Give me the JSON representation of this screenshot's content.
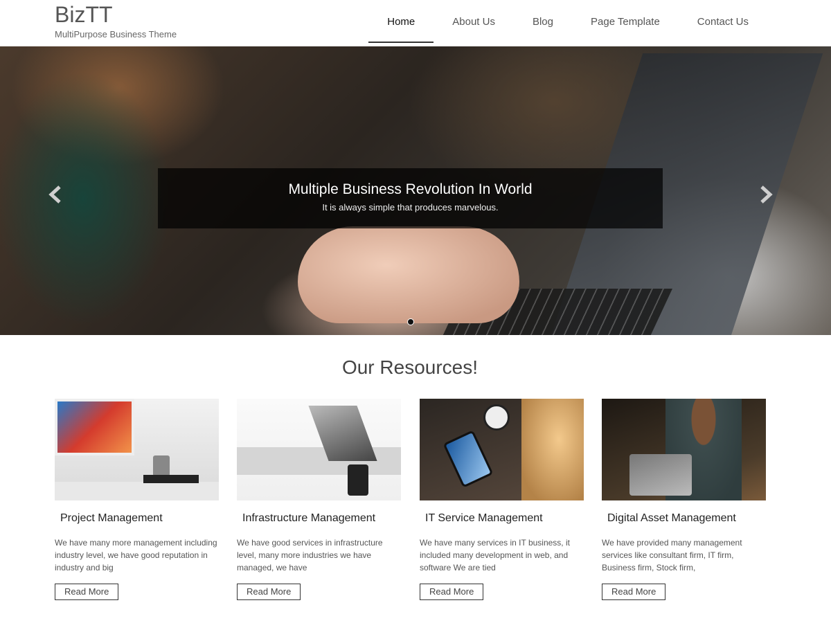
{
  "header": {
    "site_title": "BizTT",
    "tagline": "MultiPurpose Business Theme",
    "nav": [
      {
        "label": "Home",
        "active": true
      },
      {
        "label": "About Us",
        "active": false
      },
      {
        "label": "Blog",
        "active": false
      },
      {
        "label": "Page Template",
        "active": false
      },
      {
        "label": "Contact Us",
        "active": false
      }
    ]
  },
  "slider": {
    "caption_title": "Multiple Business Revolution In World",
    "caption_text": "It is always simple that produces marvelous.",
    "prev_icon": "chevron-left-icon",
    "next_icon": "chevron-right-icon",
    "current_slide": 1,
    "total_slides": 1
  },
  "resources": {
    "title": "Our Resources!",
    "cards": [
      {
        "title": "Project Management",
        "text": "We have many more management including industry level, we have good reputation in industry and big",
        "button": "Read More"
      },
      {
        "title": "Infrastructure Management",
        "text": "We have good services in infrastructure level, many more industries we have managed, we have",
        "button": "Read More"
      },
      {
        "title": "IT Service Management",
        "text": "We have many services in IT business, it included many development in web, and software We are tied",
        "button": "Read More"
      },
      {
        "title": "Digital Asset Management",
        "text": "We have provided many management services like consultant firm, IT firm, Business firm, Stock firm,",
        "button": "Read More"
      }
    ]
  }
}
